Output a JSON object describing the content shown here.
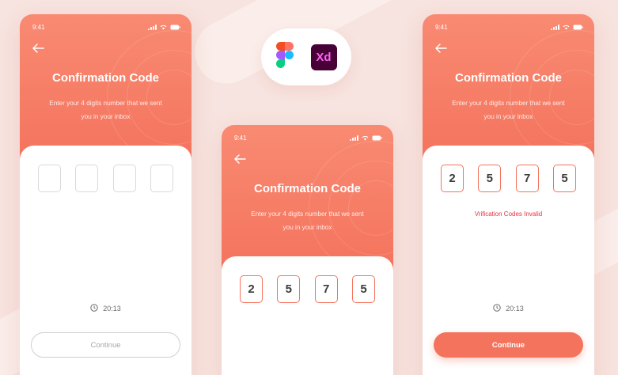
{
  "colors": {
    "accent": "#f4735d",
    "error": "#e8333c",
    "background": "#f7e3df"
  },
  "tools": {
    "figma_icon": "figma-icon",
    "xd_label": "Xd"
  },
  "phones": {
    "left": {
      "time": "9:41",
      "title": "Confirmation Code",
      "subtitle_line1": "Enter your 4 digits number that we sent",
      "subtitle_line2": "you in your inbox",
      "code_digits": [
        "",
        "",
        "",
        ""
      ],
      "timer": "20:13",
      "button_label": "Continue"
    },
    "middle": {
      "time": "9:41",
      "title": "Confirmation Code",
      "subtitle_line1": "Enter your 4 digits number that we sent",
      "subtitle_line2": "you in your inbox",
      "code_digits": [
        "2",
        "5",
        "7",
        "5"
      ]
    },
    "right": {
      "time": "9:41",
      "title": "Confirmation Code",
      "subtitle_line1": "Enter your 4 digits number that we sent",
      "subtitle_line2": "you in your inbox",
      "code_digits": [
        "2",
        "5",
        "7",
        "5"
      ],
      "error": "Vrification Codes Invalid",
      "timer": "20:13",
      "button_label": "Continue"
    }
  }
}
